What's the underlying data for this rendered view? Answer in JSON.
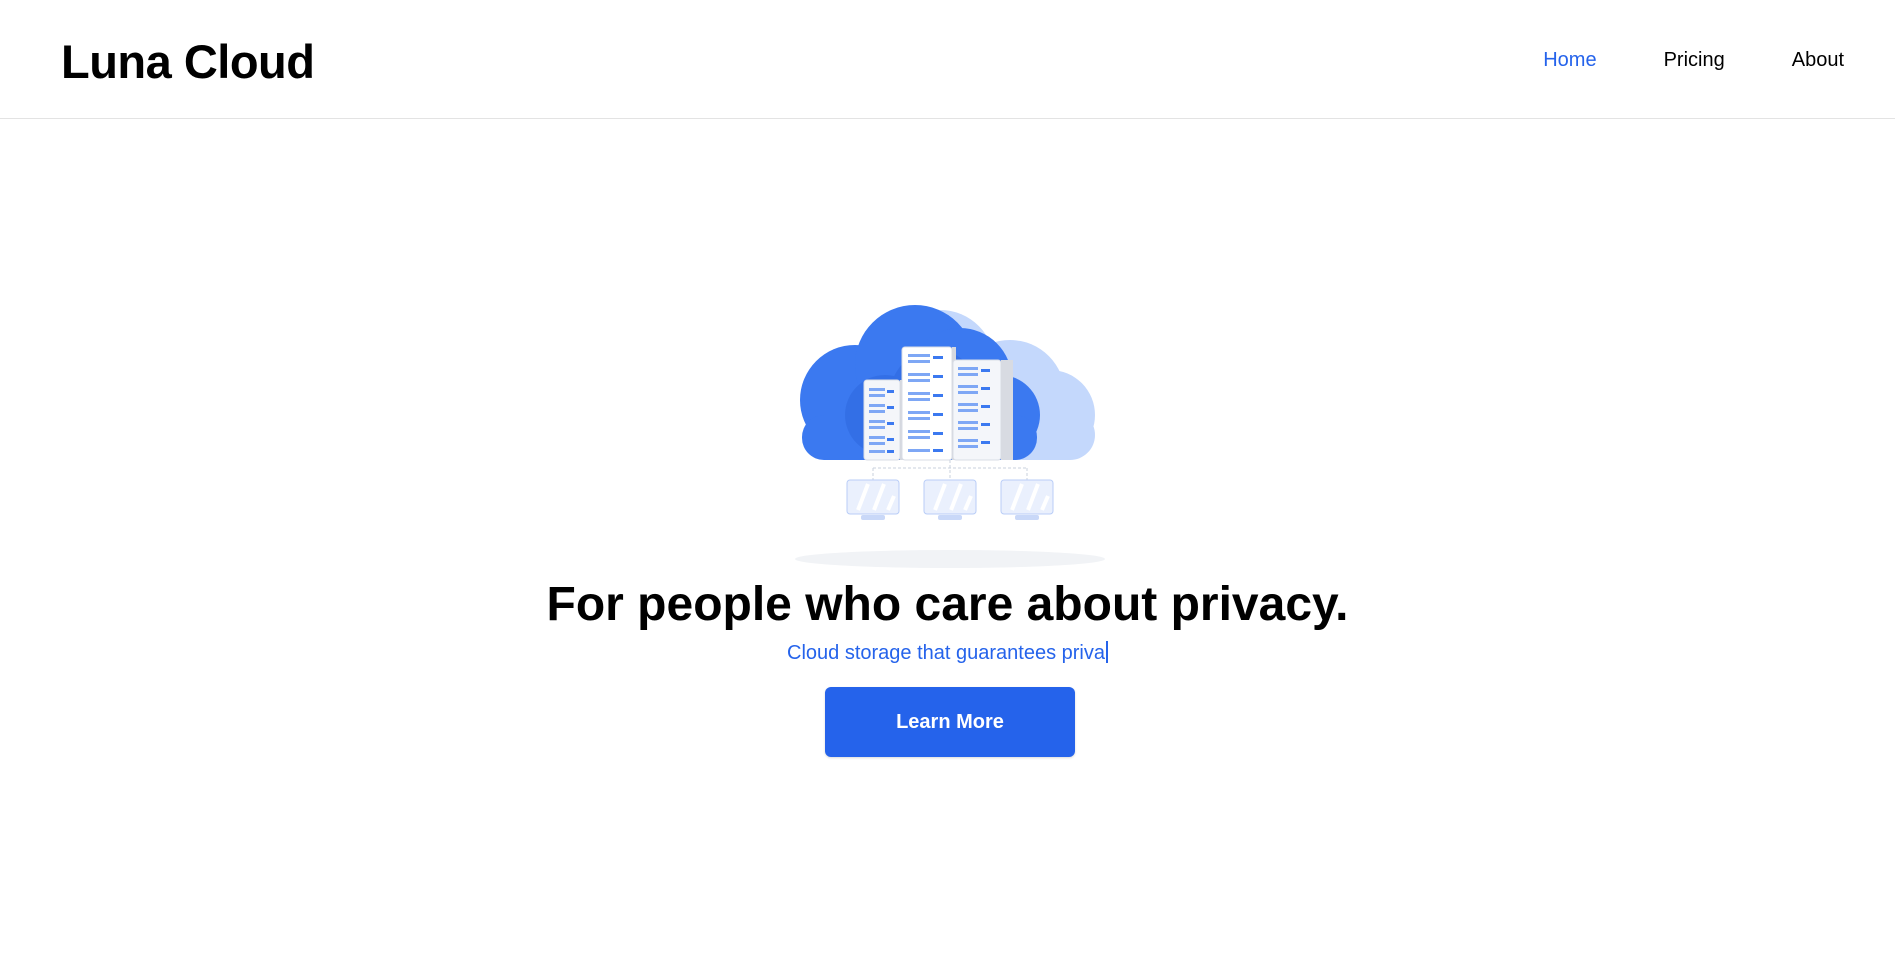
{
  "brand": {
    "name": "Luna Cloud",
    "accent_color": "#2563eb"
  },
  "nav": {
    "items": [
      {
        "label": "Home",
        "active": true
      },
      {
        "label": "Pricing",
        "active": false
      },
      {
        "label": "About",
        "active": false
      }
    ]
  },
  "hero": {
    "illustration": "cloud-servers-illustration",
    "headline": "For people who care about privacy.",
    "subline": "Cloud storage that guarantees priva",
    "cta_label": "Learn More"
  }
}
